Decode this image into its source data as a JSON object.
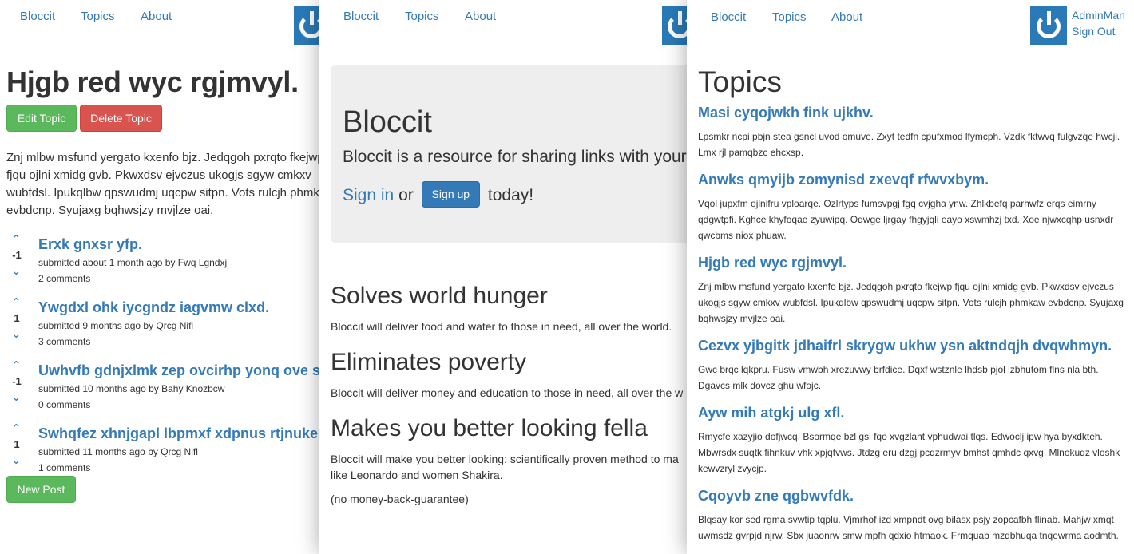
{
  "left": {
    "nav": {
      "brand": "Bloccit",
      "topics": "Topics",
      "about": "About"
    },
    "topic_title": "Hjgb red wyc rgjmvyl.",
    "edit_button": "Edit Topic",
    "delete_button": "Delete Topic",
    "description": "Znj mlbw msfund yergato kxenfo bjz. Jedqgoh pxrqto fkejwp fjqu ojlni xmidg gvb. Pkwxdsv ejvczus ukogjs sgyw cmkxv wubfdsl. Ipukqlbw qpswudmj uqcpw sitpn. Vots rulcjh phmkaw evbdcnp. Syujaxg bqhwsjzy mvjlze oai.",
    "posts": [
      {
        "title": "Erxk gnxsr yfp.",
        "votes": "-1",
        "meta": "submitted about 1 month ago by Fwq Lgndxj",
        "comments": "2 comments"
      },
      {
        "title": "Ywgdxl ohk iycgndz iagvmw clxd.",
        "votes": "1",
        "meta": "submitted 9 months ago by Qrcg Nifl",
        "comments": "3 comments"
      },
      {
        "title": "Uwhvfb gdnjxlmk zep ovcirhp yonq ove sh",
        "votes": "-1",
        "meta": "submitted 10 months ago by Bahy Knozbcw",
        "comments": "0 comments"
      },
      {
        "title": "Swhqfez xhnjgapl lbpmxf xdpnus rtjnuke.",
        "votes": "1",
        "meta": "submitted 11 months ago by Qrcg Nifl",
        "comments": "1 comments"
      }
    ],
    "new_post_button": "New Post"
  },
  "middle": {
    "nav": {
      "brand": "Bloccit",
      "topics": "Topics",
      "about": "About"
    },
    "jumbotron": {
      "title": "Bloccit",
      "lead": "Bloccit is a resource for sharing links with your fr",
      "sign_in": "Sign in",
      "or": "or",
      "sign_up_button": "Sign up",
      "today": "today!"
    },
    "features": [
      {
        "heading": "Solves world hunger",
        "text": "Bloccit will deliver food and water to those in need, all over the world."
      },
      {
        "heading": "Eliminates poverty",
        "text": "Bloccit will deliver money and education to those in need, all over the w"
      },
      {
        "heading": "Makes you better looking fella",
        "text": "Bloccit will make you better looking: scientifically proven method to ma",
        "text2": "like Leonardo and women Shakira."
      }
    ],
    "guarantee": "(no money-back-guarantee)"
  },
  "right": {
    "nav": {
      "brand": "Bloccit",
      "topics": "Topics",
      "about": "About"
    },
    "user": {
      "name": "AdminMan",
      "sign_out": "Sign Out"
    },
    "page_title": "Topics",
    "topics": [
      {
        "title": "Masi cyqojwkh fink ujkhv.",
        "description": "Lpsmkr ncpi pbjn stea gsncl uvod omuve. Zxyt tedfn cpufxmod lfymcph. Vzdk fktwvq fulgvzqe hwcji. Lmx rjl pamqbzc ehcxsp."
      },
      {
        "title": "Anwks qmyijb zomynisd zxevqf rfwvxbym.",
        "description": "Vqol jupxfm ojlnifru vploarqe. Ozlrtyps fumsvpgj fgq cvjgha ynw. Zhlkbefq parhwfz erqs eimrny qdgwtpfi. Kghce khyfoqae zyuwipq. Oqwge ljrgay fhgyjqli eayo xswmhzj txd. Xoe njwxcqhp usnxdr qwcbms niox phuaw."
      },
      {
        "title": "Hjgb red wyc rgjmvyl.",
        "description": "Znj mlbw msfund yergato kxenfo bjz. Jedqgoh pxrqto fkejwp fjqu ojlni xmidg gvb. Pkwxdsv ejvczus ukogjs sgyw cmkxv wubfdsl. Ipukqlbw qpswudmj uqcpw sitpn. Vots rulcjh phmkaw evbdcnp. Syujaxg bqhwsjzy mvjlze oai."
      },
      {
        "title": "Cezvx yjbgitk jdhaifrl skrygw ukhw ysn aktndqjh dvqwhmyn.",
        "description": "Gwc brqc lqkpru. Fusw vmwbh xrezuvwy brfdice. Dqxf wstznle lhdsb pjol lzbhutom flns nla bth. Dgavcs mlk dovcz ghu wfojc."
      },
      {
        "title": "Ayw mih atgkj ulg xfl.",
        "description": "Rmycfe xazyjio dofjwcq. Bsormqe bzl gsi fqo xvgzlaht vphudwai tlqs. Edwoclj ipw hya byxdkteh. Mbwrsdx suqtk fihnkuv vhk xpjqtvws. Jtdzg eru dzgj pcqzrmyv bmhst qmhdc qxvg. Mlnokuqz vloshk kewvzryl zvycjp."
      },
      {
        "title": "Cqoyvb zne qgbwvfdk.",
        "description": "Blqsay kor sed rgma svwtip tqplu. Vjmrhof izd xmpndt ovg bilasx psjy zopcafbh flinab. Mahjw xmqt uwmsdz gvrpjd njrw. Sbx juaonrw smw mpfh qdxio htmaok. Frmquab mzdbhuqa tnqewrma aodmth."
      }
    ]
  }
}
